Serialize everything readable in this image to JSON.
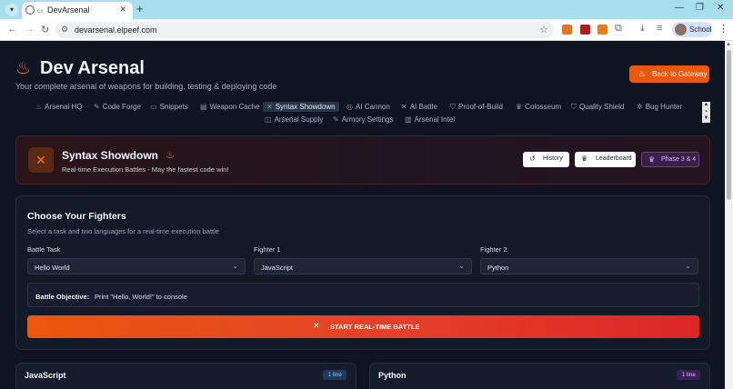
{
  "browser": {
    "tab_title": "DevArsenal",
    "url": "devarsenal.elpeef.com",
    "profile_name": "School"
  },
  "header": {
    "title": "Dev Arsenal",
    "subtitle": "Your complete arsenal of weapons for building, testing & deploying code",
    "gateway_button": "Back to Gateway"
  },
  "nav": {
    "items": [
      {
        "label": "Arsenal HQ",
        "icon": "flame-icon"
      },
      {
        "label": "Code Forge",
        "icon": "wrench-icon"
      },
      {
        "label": "Snippets",
        "icon": "folder-icon"
      },
      {
        "label": "Weapon Cache",
        "icon": "archive-icon"
      },
      {
        "label": "Syntax Showdown",
        "icon": "swords-icon",
        "active": true
      },
      {
        "label": "AI Cannon",
        "icon": "target-icon"
      },
      {
        "label": "AI Battle",
        "icon": "swords-icon"
      },
      {
        "label": "Proof-of-Build",
        "icon": "shield-icon"
      },
      {
        "label": "Colosseum",
        "icon": "trophy-icon"
      },
      {
        "label": "Quality Shield",
        "icon": "shield-icon"
      },
      {
        "label": "Bug Hunter",
        "icon": "bug-icon"
      },
      {
        "label": "Arsenal Supply",
        "icon": "box-icon"
      },
      {
        "label": "Armory Settings",
        "icon": "wrench-icon"
      },
      {
        "label": "Arsenal Intel",
        "icon": "chart-icon"
      }
    ]
  },
  "banner": {
    "title": "Syntax Showdown",
    "subtitle": "Real-time Execution Battles - May the fastest code win!",
    "history_button": "History",
    "leaderboard_button": "Leaderboard",
    "phase_badge": "Phase 3 & 4"
  },
  "fighters": {
    "title": "Choose Your Fighters",
    "subtitle": "Select a task and two languages for a real-time execution battle",
    "task_label": "Battle Task",
    "task_value": "Hello World",
    "fighter1_label": "Fighter 1",
    "fighter1_value": "JavaScript",
    "fighter2_label": "Fighter 2",
    "fighter2_value": "Python",
    "objective_label": "Battle Objective:",
    "objective_value": "Print \"Hello, World!\" to console",
    "start_button": "START REAL-TIME BATTLE"
  },
  "cards": [
    {
      "name": "JavaScript",
      "badge": "1 line",
      "badge_color": "#93c5fd"
    },
    {
      "name": "Python",
      "badge": "1 line",
      "badge_color": "#d8b4fe"
    }
  ],
  "colors": {
    "accent": "#ea580c",
    "page_bg": "#0e1422",
    "banner_border": "#4a2024"
  }
}
